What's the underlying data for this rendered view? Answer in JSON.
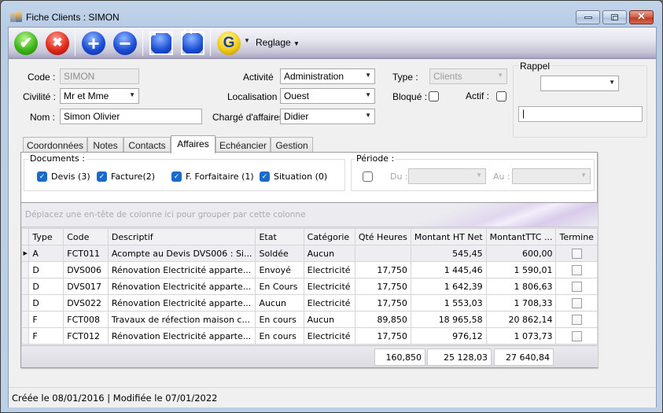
{
  "window": {
    "title": "Fiche Clients : SIMON",
    "controls": {
      "minimize": "minimize",
      "maximize": "maximize",
      "close": "✕"
    }
  },
  "toolbar": {
    "buttons": [
      {
        "name": "validate",
        "icon": "check-icon",
        "glyph": "✔"
      },
      {
        "name": "cancel",
        "icon": "x-icon",
        "glyph": "✖"
      },
      {
        "name": "add",
        "icon": "plus-icon",
        "glyph": "+"
      },
      {
        "name": "remove",
        "icon": "minus-icon",
        "glyph": "−"
      },
      {
        "name": "save",
        "icon": "floppy-icon"
      },
      {
        "name": "print",
        "icon": "printer-icon"
      },
      {
        "name": "refresh",
        "icon": "refresh-icon",
        "glyph": "G"
      }
    ],
    "dropdown_glyph": "▼",
    "reglage_label": "Reglage"
  },
  "form": {
    "code": {
      "label": "Code :",
      "value": "SIMON"
    },
    "civilite": {
      "label": "Civilité :",
      "value": "Mr et Mme"
    },
    "nom": {
      "label": "Nom :",
      "value": "Simon Olivier"
    },
    "activite": {
      "label": "Activité",
      "value": "Administration"
    },
    "localisation": {
      "label": "Localisation",
      "value": "Ouest"
    },
    "charge_affaires": {
      "label": "Chargé d'affaires",
      "value": "Didier"
    },
    "type": {
      "label": "Type :",
      "value": "Clients"
    },
    "bloque": {
      "label": "Bloqué :",
      "checked": false
    },
    "actif": {
      "label": "Actif :",
      "checked": false
    },
    "rappel": {
      "label": "Rappel",
      "combo_value": "",
      "text_value": "|"
    }
  },
  "tabs": [
    {
      "label": "Coordonnées",
      "active": false
    },
    {
      "label": "Notes",
      "active": false
    },
    {
      "label": "Contacts",
      "active": false
    },
    {
      "label": "Affaires",
      "active": true
    },
    {
      "label": "Echéancier",
      "active": false
    },
    {
      "label": "Gestion",
      "active": false
    }
  ],
  "affaires": {
    "documents": {
      "label": "Documents :",
      "filters": [
        {
          "label": "Devis (3)",
          "checked": true
        },
        {
          "label": "Facture(2)",
          "checked": true
        },
        {
          "label": "F. Forfaitaire (1)",
          "checked": true
        },
        {
          "label": "Situation (0)",
          "checked": true
        }
      ]
    },
    "periode": {
      "label": "Période :",
      "enabled": false,
      "du_label": "Du :",
      "du_value": "",
      "au_label": "Au :",
      "au_value": ""
    },
    "grid": {
      "group_hint": "Déplacez une en-tête de colonne ici pour grouper par cette colonne",
      "row_indicator": "▶",
      "columns": [
        "Type",
        "Code",
        "Descriptif",
        "Etat",
        "Catégorie",
        "Qté Heures",
        "Montant HT Net",
        "MontantTTC ...",
        "Termine"
      ],
      "rows": [
        {
          "type": "A",
          "code": "FCT011",
          "descriptif": "Acompte au Devis DVS006 : Si...",
          "etat": "Soldée",
          "categorie": "Aucun",
          "qte_heures": "",
          "montant_ht": "545,45",
          "montant_ttc": "600,00",
          "termine": false
        },
        {
          "type": "D",
          "code": "DVS006",
          "descriptif": "Rénovation Electricité apparte...",
          "etat": "Envoyé",
          "categorie": "Electricité",
          "qte_heures": "17,750",
          "montant_ht": "1 445,46",
          "montant_ttc": "1 590,01",
          "termine": false
        },
        {
          "type": "D",
          "code": "DVS017",
          "descriptif": "Rénovation Electricité apparte...",
          "etat": "En Cours",
          "categorie": "Electricité",
          "qte_heures": "17,750",
          "montant_ht": "1 642,39",
          "montant_ttc": "1 806,63",
          "termine": false
        },
        {
          "type": "D",
          "code": "DVS022",
          "descriptif": "Rénovation Electricité apparte...",
          "etat": "Aucun",
          "categorie": "Electricité",
          "qte_heures": "17,750",
          "montant_ht": "1 553,03",
          "montant_ttc": "1 708,33",
          "termine": false
        },
        {
          "type": "F",
          "code": "FCT008",
          "descriptif": "Travaux de réfection maison c...",
          "etat": "En cours",
          "categorie": "Aucun",
          "qte_heures": "89,850",
          "montant_ht": "18 965,58",
          "montant_ttc": "20 862,14",
          "termine": false
        },
        {
          "type": "F",
          "code": "FCT012",
          "descriptif": "Rénovation Electricité apparte...",
          "etat": "En cours",
          "categorie": "Electricité",
          "qte_heures": "17,750",
          "montant_ht": "976,12",
          "montant_ttc": "1 073,73",
          "termine": false
        }
      ],
      "totals": {
        "qte_heures": "160,850",
        "montant_ht": "25 128,03",
        "montant_ttc": "27 640,84"
      }
    }
  },
  "status_bar": {
    "text": "Créée le 08/01/2016 | Modifiée le 07/01/2022"
  }
}
